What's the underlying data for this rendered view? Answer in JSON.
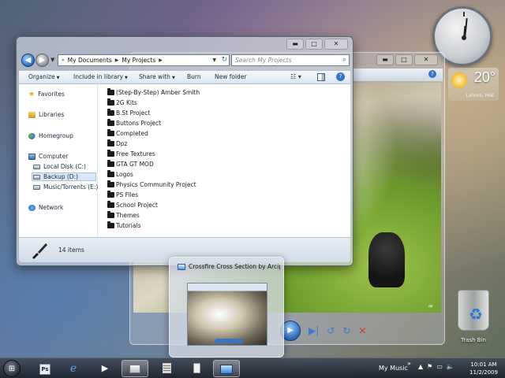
{
  "explorer": {
    "breadcrumb": [
      "My Documents",
      "My Projects"
    ],
    "search_placeholder": "Search My Projects",
    "toolbar": {
      "organize": "Organize",
      "include": "Include in library",
      "share": "Share with",
      "burn": "Burn",
      "new_folder": "New folder"
    },
    "nav": {
      "favorites": "Favorites",
      "libraries": "Libraries",
      "homegroup": "Homegroup",
      "computer": "Computer",
      "local_disk": "Local Disk (C:)",
      "backup": "Backup (D:)",
      "music": "Music/Torrents (E:)",
      "network": "Network"
    },
    "folders": [
      "(Step-By-Step) Amber Smith",
      "2G Kits",
      "B.St Project",
      "Buttons Project",
      "Completed",
      "Dpz",
      "Free Textures",
      "GTA GT MOD",
      "Logos",
      "Physics Community Project",
      "PS Files",
      "School Project",
      "Themes",
      "Tutorials"
    ],
    "item_count": "14 items"
  },
  "thumbnail": {
    "title": "Crossfire Cross Section by Arcip..."
  },
  "weather": {
    "temp": "20°",
    "city": "Lahore, PAK"
  },
  "desktop": {
    "trash_label": "Trash Bin"
  },
  "taskbar": {
    "toolbar_label": "My Music",
    "time": "10:01 AM",
    "date": "11/2/2009",
    "ps_label": "Ps"
  },
  "colors": {
    "accent": "#2c6bbd",
    "close_red": "#d23a3a",
    "selection": "#d9e7f6"
  }
}
